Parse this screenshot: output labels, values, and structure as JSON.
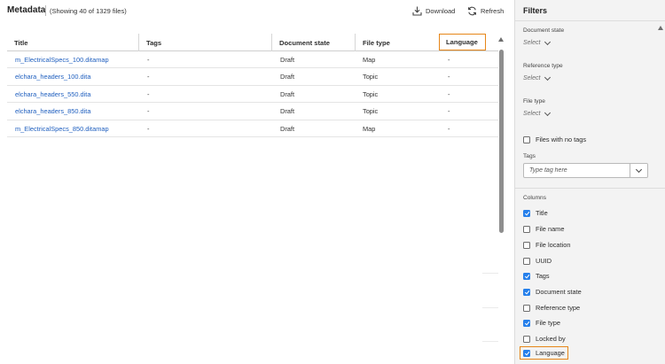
{
  "header": {
    "title": "Metadata",
    "count_text": "(Showing 40 of 1329 files)",
    "download_label": "Download",
    "refresh_label": "Refresh"
  },
  "table": {
    "columns": [
      "Title",
      "Tags",
      "Document state",
      "File type",
      "Language"
    ],
    "rows": [
      [
        "m_ElectricalSpecs_100.ditamap",
        "-",
        "Draft",
        "Map",
        "-"
      ],
      [
        "elchara_headers_100.dita",
        "-",
        "Draft",
        "Topic",
        "-"
      ],
      [
        "elchara_headers_550.dita",
        "-",
        "Draft",
        "Topic",
        "-"
      ],
      [
        "elchara_headers_850.dita",
        "-",
        "Draft",
        "Topic",
        "-"
      ],
      [
        "m_ElectricalSpecs_850.ditamap",
        "-",
        "Draft",
        "Map",
        "-"
      ]
    ],
    "highlighted_column": "Language"
  },
  "filters": {
    "title": "Filters",
    "document_state": {
      "label": "Document state",
      "value": "Select"
    },
    "reference_type": {
      "label": "Reference type",
      "value": "Select"
    },
    "file_type": {
      "label": "File type",
      "value": "Select"
    },
    "files_no_tags": {
      "label": "Files with no tags",
      "checked": false
    },
    "tags": {
      "label": "Tags",
      "placeholder": "Type tag here"
    },
    "columns_label": "Columns",
    "columns": [
      {
        "label": "Title",
        "checked": true
      },
      {
        "label": "File name",
        "checked": false
      },
      {
        "label": "File location",
        "checked": false
      },
      {
        "label": "UUID",
        "checked": false
      },
      {
        "label": "Tags",
        "checked": true
      },
      {
        "label": "Document state",
        "checked": true
      },
      {
        "label": "Reference type",
        "checked": false
      },
      {
        "label": "File type",
        "checked": true
      },
      {
        "label": "Locked by",
        "checked": false
      },
      {
        "label": "Language",
        "checked": true
      }
    ]
  },
  "colors": {
    "accent": "#2680eb",
    "highlight": "#e68619",
    "link": "#1f5fbf"
  },
  "icons": [
    "download-icon",
    "refresh-icon",
    "chevron-down-icon",
    "checkmark-icon"
  ]
}
